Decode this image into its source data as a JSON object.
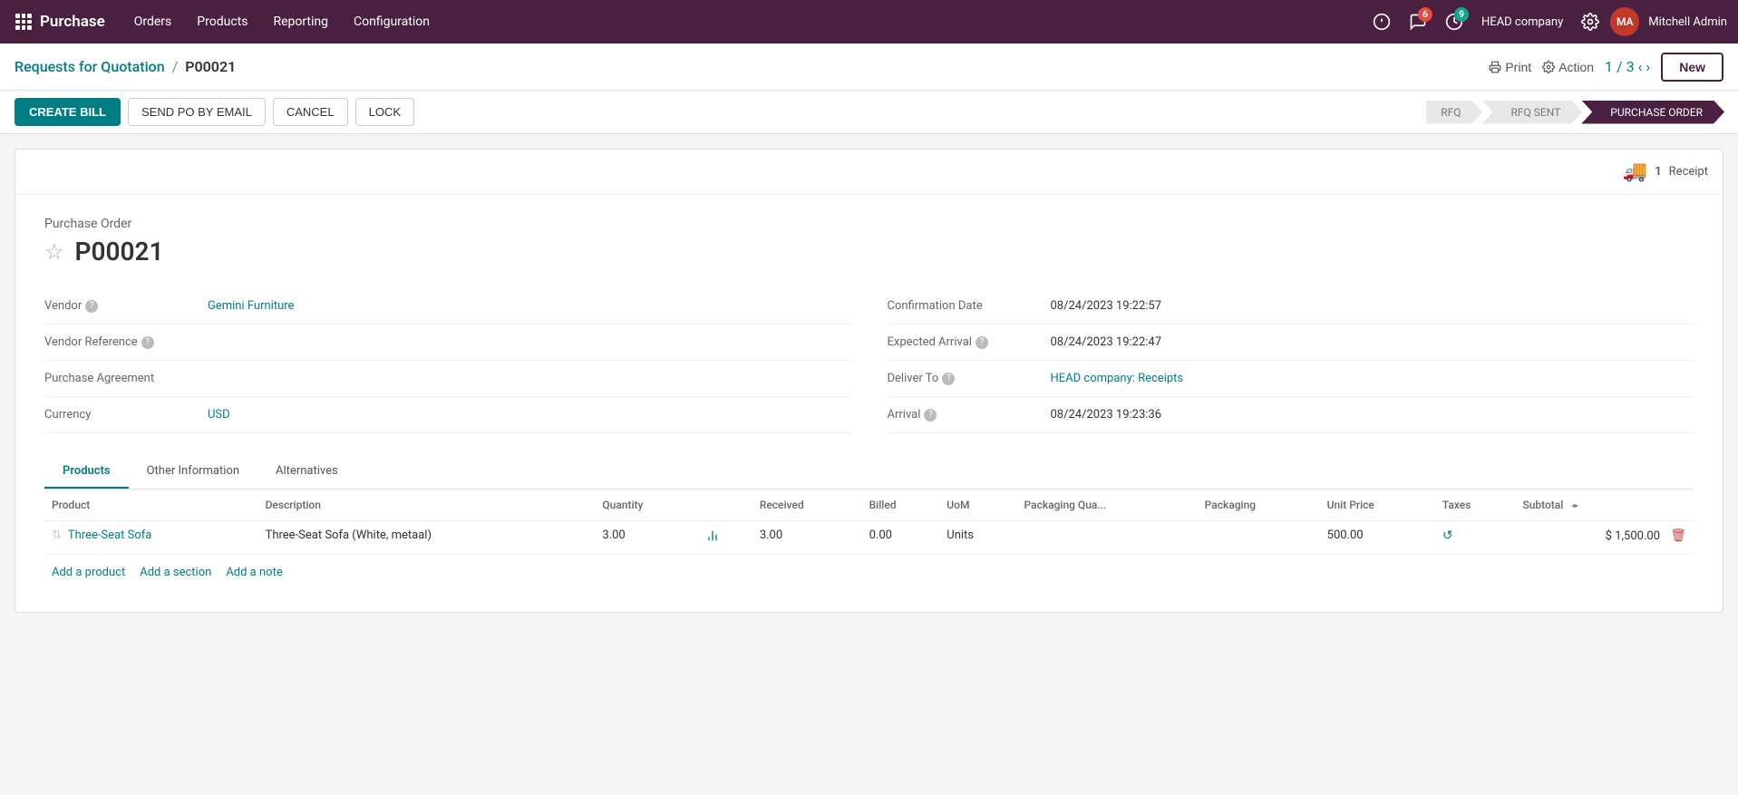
{
  "app": {
    "name": "Purchase",
    "nav_items": [
      "Orders",
      "Products",
      "Reporting",
      "Configuration"
    ]
  },
  "top_bar": {
    "notification_count": "6",
    "activity_count": "9",
    "company": "HEAD company",
    "user": "Mitchell Admin"
  },
  "breadcrumb": {
    "parent": "Requests for Quotation",
    "separator": "/",
    "current": "P00021",
    "print_label": "Print",
    "action_label": "Action",
    "pager": "1 / 3",
    "new_label": "New"
  },
  "action_buttons": {
    "create_bill": "CREATE BILL",
    "send_po_email": "SEND PO BY EMAIL",
    "cancel": "CANCEL",
    "lock": "LOCK"
  },
  "status_pipeline": {
    "steps": [
      "RFQ",
      "RFQ SENT",
      "PURCHASE ORDER"
    ],
    "active_step": "PURCHASE ORDER"
  },
  "receipt_widget": {
    "count": "1",
    "label": "Receipt"
  },
  "form": {
    "doc_type": "Purchase Order",
    "title": "P00021",
    "fields_left": [
      {
        "label": "Vendor",
        "value": "Gemini Furniture",
        "is_link": true,
        "has_help": true
      },
      {
        "label": "Vendor Reference",
        "value": "",
        "is_link": false,
        "has_help": true
      },
      {
        "label": "Purchase Agreement",
        "value": "",
        "is_link": false,
        "has_help": false
      },
      {
        "label": "Currency",
        "value": "USD",
        "is_link": true,
        "has_help": false
      }
    ],
    "fields_right": [
      {
        "label": "Confirmation Date",
        "value": "08/24/2023 19:22:57",
        "is_link": false,
        "has_help": false
      },
      {
        "label": "Expected Arrival",
        "value": "08/24/2023 19:22:47",
        "is_link": false,
        "has_help": true
      },
      {
        "label": "Deliver To",
        "value": "HEAD company: Receipts",
        "is_link": true,
        "has_help": true
      },
      {
        "label": "Arrival",
        "value": "08/24/2023 19:23:36",
        "is_link": false,
        "has_help": true
      }
    ]
  },
  "tabs": {
    "items": [
      "Products",
      "Other Information",
      "Alternatives"
    ],
    "active": "Products"
  },
  "table": {
    "columns": [
      "Product",
      "Description",
      "Quantity",
      "",
      "Received",
      "Billed",
      "UoM",
      "Packaging Qua...",
      "Packaging",
      "Unit Price",
      "Taxes",
      "Subtotal"
    ],
    "rows": [
      {
        "product": "Three-Seat Sofa",
        "description": "Three-Seat Sofa (White, metaal)",
        "quantity": "3.00",
        "received": "3.00",
        "billed": "0.00",
        "uom": "Units",
        "packaging_qty": "",
        "packaging": "",
        "unit_price": "500.00",
        "taxes": "",
        "subtotal": "$ 1,500.00"
      }
    ],
    "add_product": "Add a product",
    "add_section": "Add a section",
    "add_note": "Add a note"
  }
}
